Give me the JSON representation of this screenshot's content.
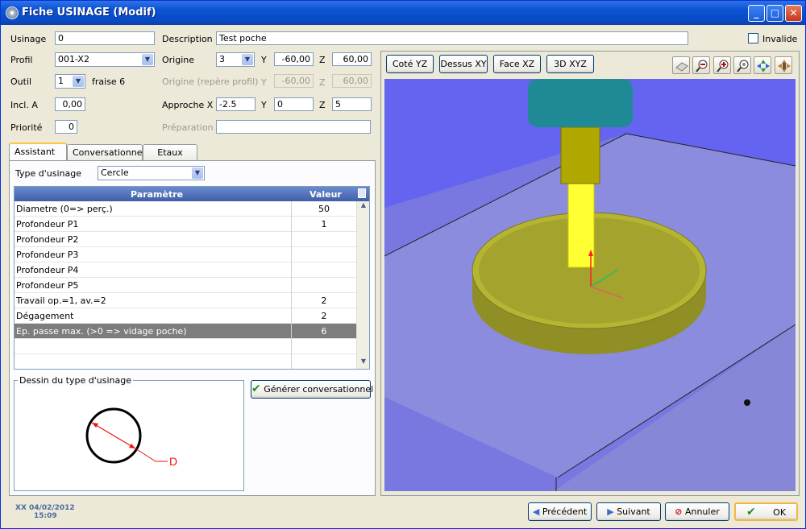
{
  "window": {
    "title": "Fiche USINAGE (Modif)",
    "min": "_",
    "max": "□",
    "close": "✕"
  },
  "form": {
    "usinage_label": "Usinage",
    "usinage_value": "0",
    "description_label": "Description",
    "description_value": "Test poche",
    "invalide_label": "Invalide",
    "profil_label": "Profil",
    "profil_value": "001-X2",
    "origine_label": "Origine",
    "origine_value": "3",
    "y_label": "Y",
    "z_label": "Z",
    "x_label": "X",
    "origine_y": "-60,00",
    "origine_z": "60,00",
    "outil_label": "Outil",
    "outil_value": "1",
    "outil_name": "fraise 6",
    "origine_repere_label": "Origine (repère profil)",
    "rep_y": "-60,00",
    "rep_z": "60,00",
    "incl_label": "Incl. A",
    "incl_value": "0,00",
    "approche_label": "Approche X",
    "approche_x": "-2.5",
    "approche_y": "0",
    "approche_z": "5",
    "priorite_label": "Priorité",
    "priorite_value": "0",
    "preparation_label": "Préparation",
    "preparation_value": ""
  },
  "tabs": [
    {
      "label": "Assistant"
    },
    {
      "label": "Conversationnel"
    },
    {
      "label": "Etaux"
    }
  ],
  "assistant": {
    "type_label": "Type d'usinage",
    "type_value": "Cercle",
    "grid_headers": {
      "param": "Paramètre",
      "value": "Valeur"
    },
    "rows": [
      {
        "param": "Diametre (0=> perç.)",
        "value": "50"
      },
      {
        "param": "Profondeur P1",
        "value": "1"
      },
      {
        "param": "Profondeur P2",
        "value": ""
      },
      {
        "param": "Profondeur P3",
        "value": ""
      },
      {
        "param": "Profondeur P4",
        "value": ""
      },
      {
        "param": "Profondeur P5",
        "value": ""
      },
      {
        "param": "Travail op.=1, av.=2",
        "value": "2"
      },
      {
        "param": "Dégagement",
        "value": "2"
      },
      {
        "param": "Ep. passe max. (>0 => vidage poche)",
        "value": "6"
      },
      {
        "param": "",
        "value": ""
      },
      {
        "param": "",
        "value": ""
      }
    ],
    "dessin_legend": "Dessin du type d'usinage",
    "dessin_label": "D",
    "generer_button": "Générer conversationnel"
  },
  "view": {
    "buttons": [
      "Coté YZ",
      "Dessus XY",
      "Face XZ",
      "3D XYZ"
    ],
    "tool_icons": [
      "cube-icon",
      "zoom-out-icon",
      "zoom-in-icon",
      "zoom-fit-icon",
      "rotate-icon",
      "pan-icon"
    ]
  },
  "footer": {
    "date": "XX 04/02/2012",
    "time": "15:09",
    "precedent": "Précédent",
    "suivant": "Suivant",
    "annuler": "Annuler",
    "ok": "OK"
  },
  "colors": {
    "accent": "#0a49c2",
    "viewport_bg": "#6464f0",
    "selected_row": "#7d7d7d"
  }
}
